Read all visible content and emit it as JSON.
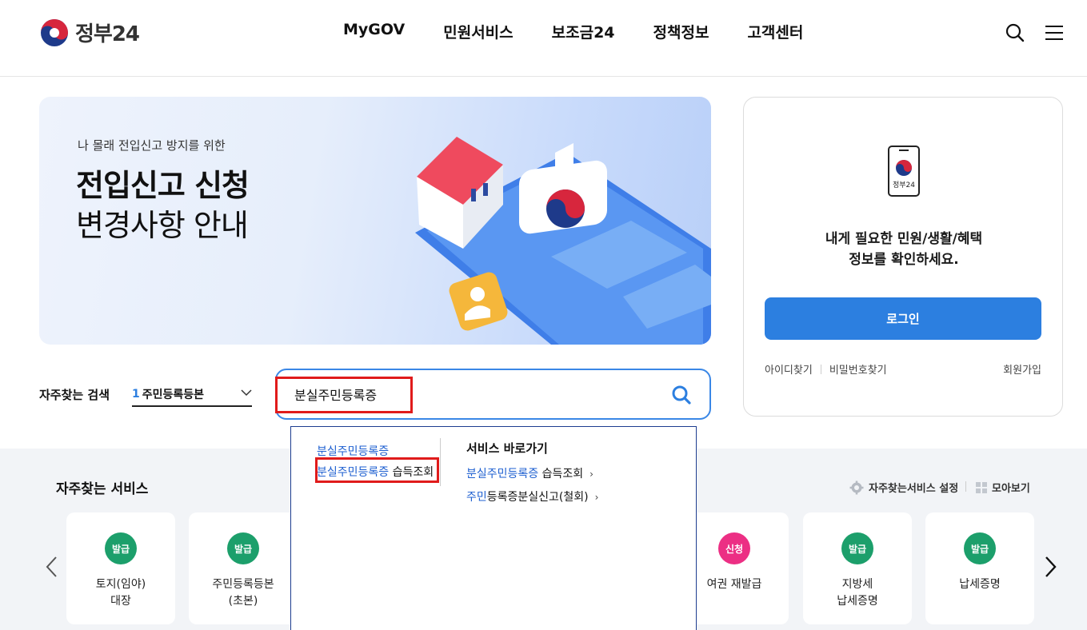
{
  "header": {
    "logo_text": "정부24",
    "nav": [
      "MyGOV",
      "민원서비스",
      "보조금24",
      "정책정보",
      "고객센터"
    ],
    "icons": [
      "search-icon",
      "hamburger-menu-icon"
    ]
  },
  "banner": {
    "subtitle": "나 몰래 전입신고 방지를 위한",
    "title_line1": "전입신고 신청",
    "title_line2": "변경사항 안내"
  },
  "login": {
    "phone_caption": "정부24",
    "message_line1": "내게 필요한 민원/생활/혜택",
    "message_line2": "정보를 확인하세요.",
    "login_button": "로그인",
    "find_id": "아이디찾기",
    "find_password": "비밀번호찾기",
    "join": "회원가입"
  },
  "frequent_search": {
    "label": "자주찾는 검색",
    "selected_number": "1",
    "selected_text": "주민등록등본"
  },
  "search": {
    "value": "분실주민등록증",
    "placeholder": ""
  },
  "autocomplete": {
    "suggestions": [
      {
        "match": "분실주민등록증",
        "rest": ""
      },
      {
        "match": "분실주민등록증",
        "rest": " 습득조회"
      }
    ],
    "shortcut_heading": "서비스 바로가기",
    "shortcuts": [
      {
        "match": "분실주민등록증",
        "rest": " 습득조회",
        "arrow": "›"
      },
      {
        "match": "주민",
        "rest": "등록증분실신고(철회)",
        "arrow": "›"
      }
    ]
  },
  "services": {
    "title": "자주찾는 서비스",
    "settings_label": "자주찾는서비스 설정",
    "collect_label": "모아보기",
    "cards": [
      {
        "badge": "발급",
        "badge_color": "#1c9f6b",
        "line1": "토지(임야)",
        "line2": "대장"
      },
      {
        "badge": "발급",
        "badge_color": "#1c9f6b",
        "line1": "주민등록등본",
        "line2": "(초본)"
      },
      {
        "badge": "신청",
        "badge_color": "#ec2f84",
        "line1": "여권 재발급",
        "line2": ""
      },
      {
        "badge": "발급",
        "badge_color": "#1c9f6b",
        "line1": "지방세",
        "line2": "납세증명"
      },
      {
        "badge": "발급",
        "badge_color": "#1c9f6b",
        "line1": "납세증명",
        "line2": ""
      }
    ]
  },
  "colors": {
    "accent": "#2c7fe0",
    "highlight": "#e01b1b",
    "issue_green": "#1c9f6b",
    "apply_pink": "#ec2f84"
  }
}
